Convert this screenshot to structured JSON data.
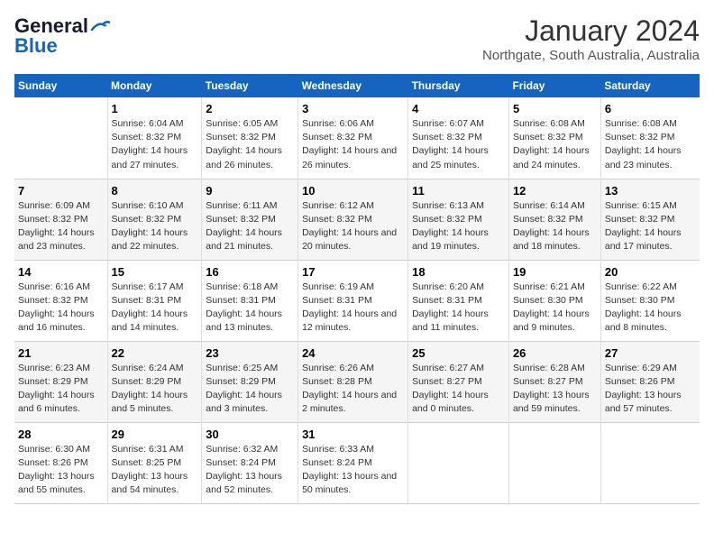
{
  "logo": {
    "line1": "General",
    "line2": "Blue"
  },
  "title": "January 2024",
  "subtitle": "Northgate, South Australia, Australia",
  "days_header": [
    "Sunday",
    "Monday",
    "Tuesday",
    "Wednesday",
    "Thursday",
    "Friday",
    "Saturday"
  ],
  "weeks": [
    [
      {
        "num": "",
        "info": ""
      },
      {
        "num": "1",
        "info": "Sunrise: 6:04 AM\nSunset: 8:32 PM\nDaylight: 14 hours\nand 27 minutes."
      },
      {
        "num": "2",
        "info": "Sunrise: 6:05 AM\nSunset: 8:32 PM\nDaylight: 14 hours\nand 26 minutes."
      },
      {
        "num": "3",
        "info": "Sunrise: 6:06 AM\nSunset: 8:32 PM\nDaylight: 14 hours\nand 26 minutes."
      },
      {
        "num": "4",
        "info": "Sunrise: 6:07 AM\nSunset: 8:32 PM\nDaylight: 14 hours\nand 25 minutes."
      },
      {
        "num": "5",
        "info": "Sunrise: 6:08 AM\nSunset: 8:32 PM\nDaylight: 14 hours\nand 24 minutes."
      },
      {
        "num": "6",
        "info": "Sunrise: 6:08 AM\nSunset: 8:32 PM\nDaylight: 14 hours\nand 23 minutes."
      }
    ],
    [
      {
        "num": "7",
        "info": "Sunrise: 6:09 AM\nSunset: 8:32 PM\nDaylight: 14 hours\nand 23 minutes."
      },
      {
        "num": "8",
        "info": "Sunrise: 6:10 AM\nSunset: 8:32 PM\nDaylight: 14 hours\nand 22 minutes."
      },
      {
        "num": "9",
        "info": "Sunrise: 6:11 AM\nSunset: 8:32 PM\nDaylight: 14 hours\nand 21 minutes."
      },
      {
        "num": "10",
        "info": "Sunrise: 6:12 AM\nSunset: 8:32 PM\nDaylight: 14 hours\nand 20 minutes."
      },
      {
        "num": "11",
        "info": "Sunrise: 6:13 AM\nSunset: 8:32 PM\nDaylight: 14 hours\nand 19 minutes."
      },
      {
        "num": "12",
        "info": "Sunrise: 6:14 AM\nSunset: 8:32 PM\nDaylight: 14 hours\nand 18 minutes."
      },
      {
        "num": "13",
        "info": "Sunrise: 6:15 AM\nSunset: 8:32 PM\nDaylight: 14 hours\nand 17 minutes."
      }
    ],
    [
      {
        "num": "14",
        "info": "Sunrise: 6:16 AM\nSunset: 8:32 PM\nDaylight: 14 hours\nand 16 minutes."
      },
      {
        "num": "15",
        "info": "Sunrise: 6:17 AM\nSunset: 8:31 PM\nDaylight: 14 hours\nand 14 minutes."
      },
      {
        "num": "16",
        "info": "Sunrise: 6:18 AM\nSunset: 8:31 PM\nDaylight: 14 hours\nand 13 minutes."
      },
      {
        "num": "17",
        "info": "Sunrise: 6:19 AM\nSunset: 8:31 PM\nDaylight: 14 hours\nand 12 minutes."
      },
      {
        "num": "18",
        "info": "Sunrise: 6:20 AM\nSunset: 8:31 PM\nDaylight: 14 hours\nand 11 minutes."
      },
      {
        "num": "19",
        "info": "Sunrise: 6:21 AM\nSunset: 8:30 PM\nDaylight: 14 hours\nand 9 minutes."
      },
      {
        "num": "20",
        "info": "Sunrise: 6:22 AM\nSunset: 8:30 PM\nDaylight: 14 hours\nand 8 minutes."
      }
    ],
    [
      {
        "num": "21",
        "info": "Sunrise: 6:23 AM\nSunset: 8:29 PM\nDaylight: 14 hours\nand 6 minutes."
      },
      {
        "num": "22",
        "info": "Sunrise: 6:24 AM\nSunset: 8:29 PM\nDaylight: 14 hours\nand 5 minutes."
      },
      {
        "num": "23",
        "info": "Sunrise: 6:25 AM\nSunset: 8:29 PM\nDaylight: 14 hours\nand 3 minutes."
      },
      {
        "num": "24",
        "info": "Sunrise: 6:26 AM\nSunset: 8:28 PM\nDaylight: 14 hours\nand 2 minutes."
      },
      {
        "num": "25",
        "info": "Sunrise: 6:27 AM\nSunset: 8:27 PM\nDaylight: 14 hours\nand 0 minutes."
      },
      {
        "num": "26",
        "info": "Sunrise: 6:28 AM\nSunset: 8:27 PM\nDaylight: 13 hours\nand 59 minutes."
      },
      {
        "num": "27",
        "info": "Sunrise: 6:29 AM\nSunset: 8:26 PM\nDaylight: 13 hours\nand 57 minutes."
      }
    ],
    [
      {
        "num": "28",
        "info": "Sunrise: 6:30 AM\nSunset: 8:26 PM\nDaylight: 13 hours\nand 55 minutes."
      },
      {
        "num": "29",
        "info": "Sunrise: 6:31 AM\nSunset: 8:25 PM\nDaylight: 13 hours\nand 54 minutes."
      },
      {
        "num": "30",
        "info": "Sunrise: 6:32 AM\nSunset: 8:24 PM\nDaylight: 13 hours\nand 52 minutes."
      },
      {
        "num": "31",
        "info": "Sunrise: 6:33 AM\nSunset: 8:24 PM\nDaylight: 13 hours\nand 50 minutes."
      },
      {
        "num": "",
        "info": ""
      },
      {
        "num": "",
        "info": ""
      },
      {
        "num": "",
        "info": ""
      }
    ]
  ]
}
